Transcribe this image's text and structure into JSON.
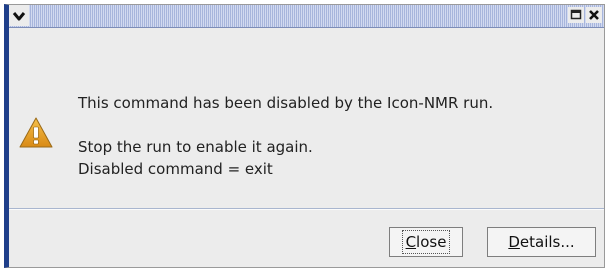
{
  "window": {
    "menu_icon": "chevron-down-icon",
    "maximize_icon": "maximize-icon",
    "close_icon": "close-icon"
  },
  "message": {
    "icon": "warning-icon",
    "line1": "This command has been disabled by the Icon-NMR run.",
    "line2": "Stop the run to enable it again.",
    "line3": "Disabled command = exit"
  },
  "buttons": {
    "close": {
      "mnemonic": "C",
      "rest": "lose"
    },
    "details": {
      "mnemonic": "D",
      "rest": "etails..."
    }
  },
  "colors": {
    "titlebar": "#b7c3e2",
    "window_bg": "#ececec",
    "warning": "#e8a020"
  }
}
